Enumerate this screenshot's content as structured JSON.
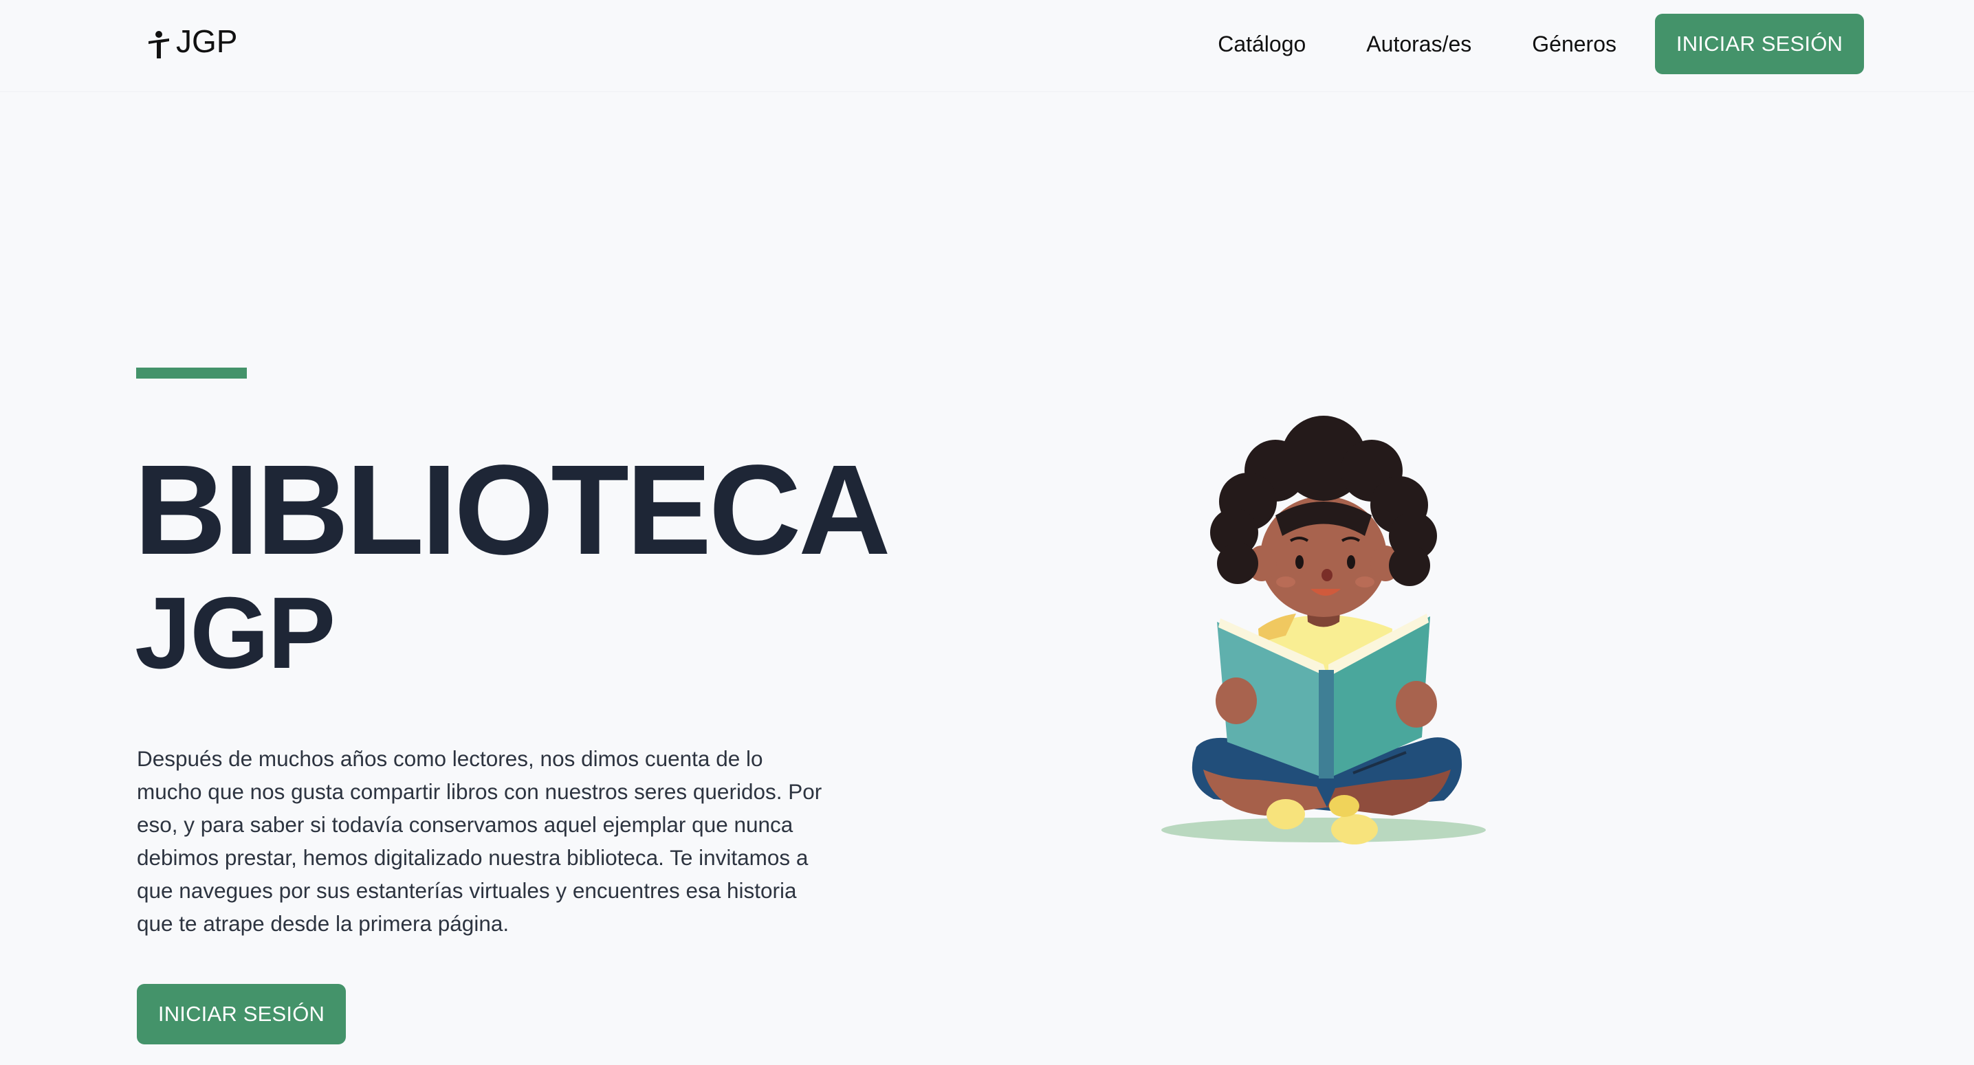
{
  "brand": {
    "name": "JGP",
    "icon": "reader-figure-icon"
  },
  "nav": {
    "links": [
      "Catálogo",
      "Autoras/es",
      "Géneros"
    ],
    "login_label": "INICIAR SESIÓN"
  },
  "hero": {
    "title": "BIBLIOTECA",
    "subtitle": "JGP",
    "text": "Después de muchos años como lectores, nos dimos cuenta de lo mucho que nos gusta compartir libros con nuestros seres queridos. Por eso, y para saber si todavía conservamos aquel ejemplar que nunca debimos prestar, hemos digitalizado nuestra biblioteca. Te invitamos a que navegues por sus estanterías virtuales y encuentres esa historia que te atrape desde la primera página.",
    "cta_label": "INICIAR SESIÓN",
    "illustration": "child-reading-book-illustration"
  },
  "colors": {
    "accent": "#44936a",
    "heading": "#1e2636",
    "background": "#f8f9fb"
  }
}
